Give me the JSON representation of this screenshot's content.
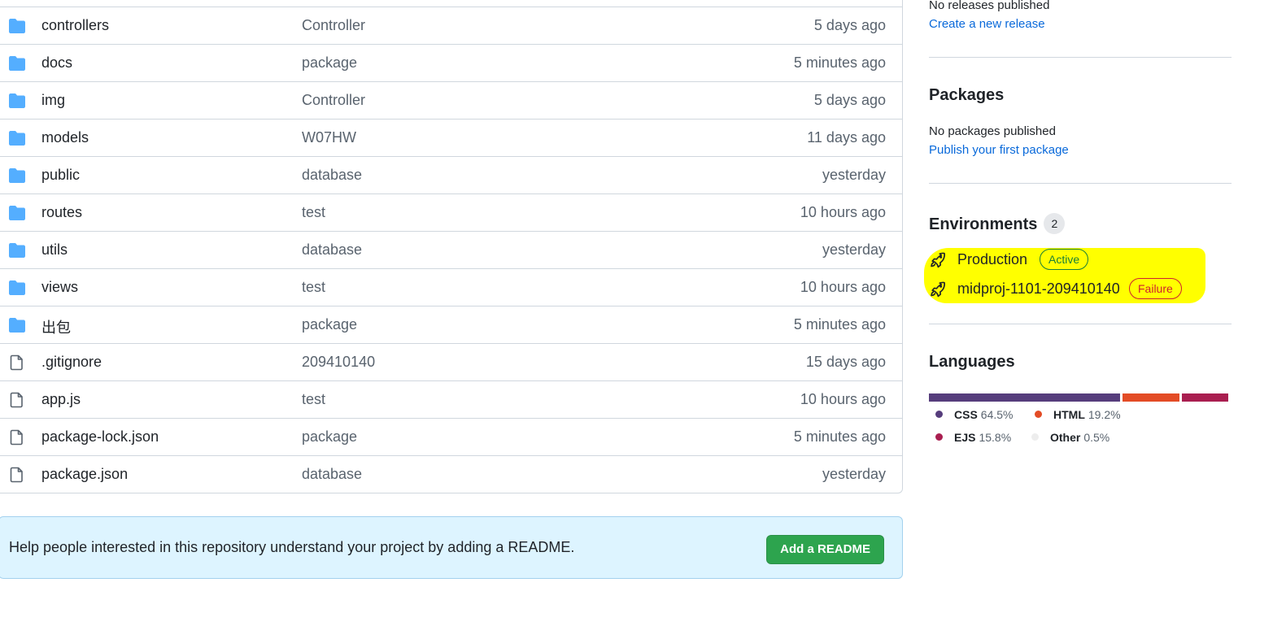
{
  "files": [
    {
      "name": "controllers",
      "type": "folder",
      "message": "Controller",
      "age": "5 days ago"
    },
    {
      "name": "docs",
      "type": "folder",
      "message": "package",
      "age": "5 minutes ago"
    },
    {
      "name": "img",
      "type": "folder",
      "message": "Controller",
      "age": "5 days ago"
    },
    {
      "name": "models",
      "type": "folder",
      "message": "W07HW",
      "age": "11 days ago"
    },
    {
      "name": "public",
      "type": "folder",
      "message": "database",
      "age": "yesterday"
    },
    {
      "name": "routes",
      "type": "folder",
      "message": "test",
      "age": "10 hours ago"
    },
    {
      "name": "utils",
      "type": "folder",
      "message": "database",
      "age": "yesterday"
    },
    {
      "name": "views",
      "type": "folder",
      "message": "test",
      "age": "10 hours ago"
    },
    {
      "name": "出包",
      "type": "folder",
      "message": "package",
      "age": "5 minutes ago"
    },
    {
      "name": ".gitignore",
      "type": "file",
      "message": "209410140",
      "age": "15 days ago"
    },
    {
      "name": "app.js",
      "type": "file",
      "message": "test",
      "age": "10 hours ago"
    },
    {
      "name": "package-lock.json",
      "type": "file",
      "message": "package",
      "age": "5 minutes ago"
    },
    {
      "name": "package.json",
      "type": "file",
      "message": "database",
      "age": "yesterday"
    }
  ],
  "readme_banner": {
    "text": "Help people interested in this repository understand your project by adding a README.",
    "button": "Add a README"
  },
  "releases": {
    "empty_text": "No releases published",
    "create_link": "Create a new release"
  },
  "packages": {
    "title": "Packages",
    "empty_text": "No packages published",
    "publish_link": "Publish your first package"
  },
  "environments": {
    "title": "Environments",
    "count": "2",
    "items": [
      {
        "name": "Production",
        "status": "Active"
      },
      {
        "name": "midproj-1101-209410140",
        "status": "Failure"
      }
    ]
  },
  "languages": {
    "title": "Languages",
    "items": [
      {
        "name": "CSS",
        "percent": "64.5%",
        "color": "#563d7c"
      },
      {
        "name": "HTML",
        "percent": "19.2%",
        "color": "#e34c26"
      },
      {
        "name": "EJS",
        "percent": "15.8%",
        "color": "#a91e50"
      },
      {
        "name": "Other",
        "percent": "0.5%",
        "color": "#ededed"
      }
    ]
  },
  "colors": {
    "link": "#0969da",
    "folder": "#54aeff",
    "highlight": "#ffff00"
  }
}
